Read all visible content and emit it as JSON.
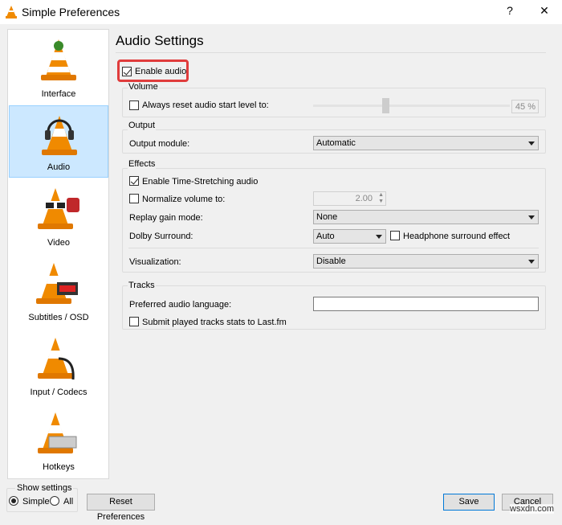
{
  "window": {
    "title": "Simple Preferences",
    "help": "?",
    "close": "✕"
  },
  "sidebar": {
    "items": [
      {
        "label": "Interface",
        "selected": false
      },
      {
        "label": "Audio",
        "selected": true
      },
      {
        "label": "Video",
        "selected": false
      },
      {
        "label": "Subtitles / OSD",
        "selected": false
      },
      {
        "label": "Input / Codecs",
        "selected": false
      },
      {
        "label": "Hotkeys",
        "selected": false
      }
    ]
  },
  "main": {
    "heading": "Audio Settings",
    "enable_audio": {
      "label": "Enable audio",
      "checked": true
    },
    "highlight_color": "#e03c3c",
    "volume": {
      "title": "Volume",
      "reset_label": "Always reset audio start level to:",
      "reset_checked": false,
      "level_percent": 45,
      "level_text": "45 %"
    },
    "output": {
      "title": "Output",
      "module_label": "Output module:",
      "module_value": "Automatic"
    },
    "effects": {
      "title": "Effects",
      "time_stretch": {
        "label": "Enable Time-Stretching audio",
        "checked": true
      },
      "normalize": {
        "label": "Normalize volume to:",
        "checked": false,
        "value": "2.00"
      },
      "replay_gain": {
        "label": "Replay gain mode:",
        "value": "None"
      },
      "dolby": {
        "label": "Dolby Surround:",
        "value": "Auto"
      },
      "headphone": {
        "label": "Headphone surround effect",
        "checked": false
      },
      "visualization": {
        "label": "Visualization:",
        "value": "Disable"
      }
    },
    "tracks": {
      "title": "Tracks",
      "language_label": "Preferred audio language:",
      "language_value": "",
      "lastfm": {
        "label": "Submit played tracks stats to Last.fm",
        "checked": false
      }
    }
  },
  "footer": {
    "show_settings": "Show settings",
    "simple": "Simple",
    "all": "All",
    "mode": "Simple",
    "reset": "Reset Preferences",
    "save": "Save",
    "cancel": "Cancel"
  },
  "watermark": "wsxdn.com"
}
